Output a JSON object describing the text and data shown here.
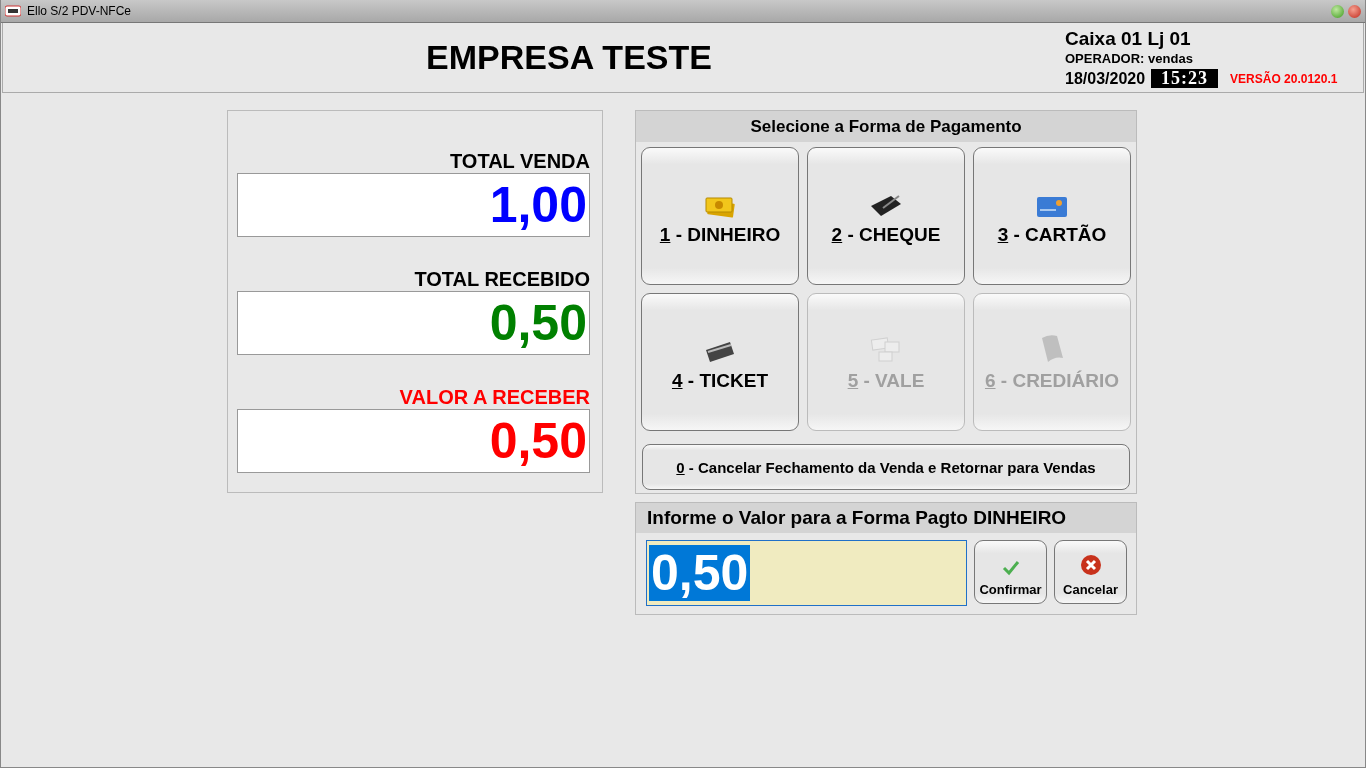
{
  "window": {
    "title": "Ello S/2 PDV-NFCe"
  },
  "header": {
    "company": "EMPRESA TESTE",
    "register": "Caixa 01 Lj 01",
    "operator": "OPERADOR: vendas",
    "date": "18/03/2020",
    "time": "15:23",
    "version": "VERSÃO 20.0120.1"
  },
  "totals": [
    {
      "label": "TOTAL VENDA",
      "value": "1,00",
      "color": "#0000ff",
      "kind": "sale"
    },
    {
      "label": "TOTAL RECEBIDO",
      "value": "0,50",
      "color": "#008000",
      "kind": "received"
    },
    {
      "label": "VALOR A RECEBER",
      "value": "0,50",
      "color": "#ff0000",
      "kind": "due"
    }
  ],
  "payment": {
    "title": "Selecione a Forma de Pagamento",
    "methods": [
      {
        "key": "1",
        "label": " - DINHEIRO",
        "kind": "cash",
        "disabled": false
      },
      {
        "key": "2",
        "label": " - CHEQUE",
        "kind": "checkbook",
        "disabled": false
      },
      {
        "key": "3",
        "label": " - CARTÃO",
        "kind": "card",
        "disabled": false
      },
      {
        "key": "4",
        "label": " - TICKET",
        "kind": "ticket",
        "disabled": false
      },
      {
        "key": "5",
        "label": " - VALE",
        "kind": "vouchers",
        "disabled": true
      },
      {
        "key": "6",
        "label": " - CREDIÁRIO",
        "kind": "booklet",
        "disabled": true
      }
    ],
    "cancel": {
      "key": "0",
      "label": " - Cancelar Fechamento da Venda e Retornar para Vendas"
    }
  },
  "amount": {
    "title": "Informe o Valor para a Forma Pagto DINHEIRO",
    "value": "0,50",
    "selected": true,
    "buttons": [
      {
        "label": "Confirmar",
        "kind": "confirm"
      },
      {
        "label": "Cancelar",
        "kind": "cancel"
      }
    ]
  }
}
